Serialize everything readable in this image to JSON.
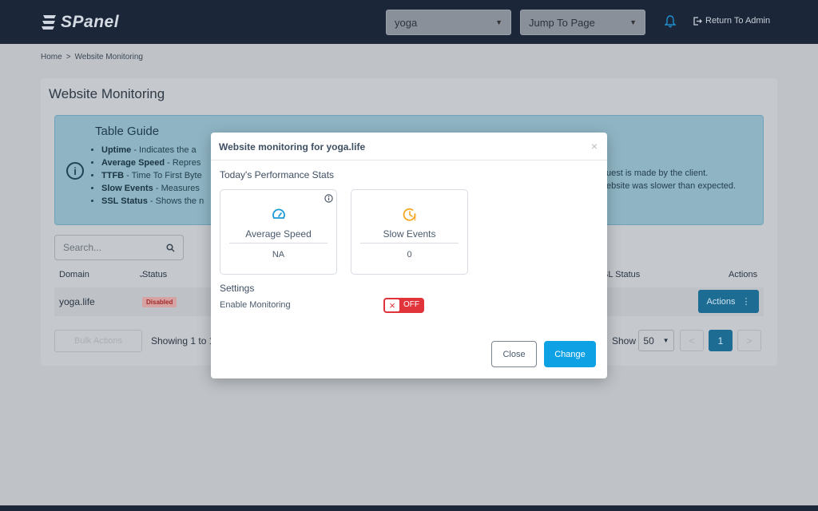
{
  "brand": {
    "name": "SPanel"
  },
  "header": {
    "site_select": "yoga",
    "jump_select": "Jump To Page",
    "return_label": "Return To Admin"
  },
  "breadcrumb": {
    "home": "Home",
    "sep": ">",
    "current": "Website Monitoring"
  },
  "page": {
    "title": "Website Monitoring"
  },
  "guide": {
    "title": "Table Guide",
    "items": [
      {
        "term": "Uptime",
        "desc": " - Indicates the a"
      },
      {
        "term": "Average Speed",
        "desc": " - Repres"
      },
      {
        "term": "TTFB",
        "desc": " - Time To First Byte"
      },
      {
        "term": "Slow Events",
        "desc": " - Measures"
      },
      {
        "term": "SSL Status",
        "desc": " - Shows the n"
      }
    ],
    "right_line1": "uest is made by the client.",
    "right_line2": "ebsite was slower than expected."
  },
  "table": {
    "search_placeholder": "Search...",
    "headers": {
      "domain": "Domain",
      "status": "Status",
      "ssl": "SL Status",
      "actions": "Actions"
    },
    "rows": [
      {
        "domain": "yoga.life",
        "status": "Disabled",
        "action": "Actions"
      }
    ],
    "bulk_label": "Bulk Actions",
    "showing": "Showing 1 to 1",
    "show_label": "Show",
    "page_size": "50",
    "pagination": {
      "prev": "<",
      "current": "1",
      "next": ">"
    }
  },
  "modal": {
    "title": "Website monitoring for yoga.life",
    "close_x": "×",
    "stats_title": "Today's Performance Stats",
    "stats": [
      {
        "label": "Average Speed",
        "value": "NA"
      },
      {
        "label": "Slow Events",
        "value": "0"
      }
    ],
    "settings_title": "Settings",
    "enable_label": "Enable Monitoring",
    "toggle_state": "OFF",
    "toggle_x": "×",
    "close_button": "Close",
    "change_button": "Change"
  },
  "colors": {
    "header_bg": "#1b2639",
    "accent": "#0ea1e3",
    "toggle_off": "#e0333a",
    "slow_events_icon": "#f5a623",
    "speed_icon": "#1e9bd7"
  },
  "icons": {
    "logo": "spanel-logo-icon",
    "bell": "bell-icon",
    "return": "sign-out-icon",
    "guide": "info-circle-icon",
    "search": "search-icon",
    "speed": "speedometer-icon",
    "slow": "clock-alert-icon",
    "info": "info-icon"
  }
}
